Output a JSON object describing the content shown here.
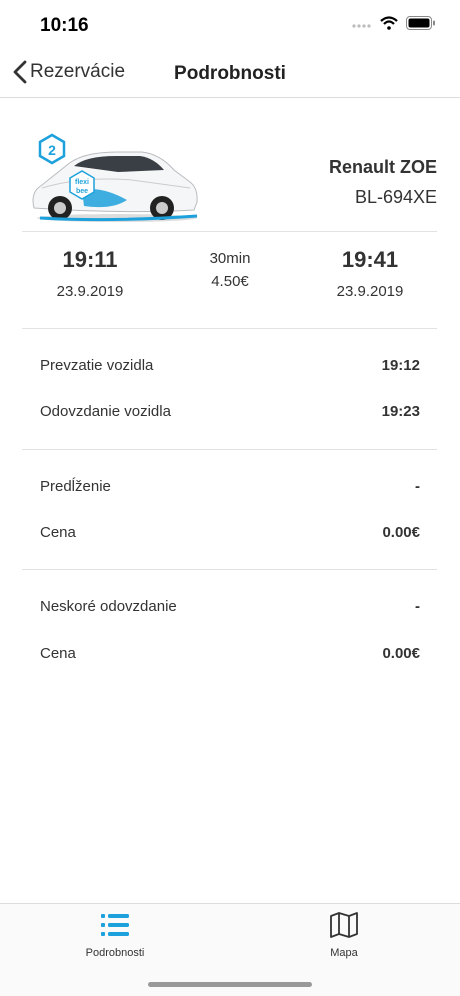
{
  "status": {
    "time": "10:16"
  },
  "nav": {
    "back_label": "Rezervácie",
    "title": "Podrobnosti"
  },
  "car": {
    "badge_number": "2",
    "brand_text_1": "flexi",
    "brand_text_2": "bee",
    "name": "Renault ZOE",
    "plate": "BL-694XE"
  },
  "booking": {
    "start_time": "19:11",
    "start_date": "23.9.2019",
    "duration": "30min",
    "price": "4.50€",
    "end_time": "19:41",
    "end_date": "23.9.2019"
  },
  "details": {
    "pickup_label": "Prevzatie vozidla",
    "pickup_value": "19:12",
    "return_label": "Odovzdanie vozidla",
    "return_value": "19:23",
    "extension_label": "Predĺženie",
    "extension_value": "-",
    "extension_price_label": "Cena",
    "extension_price_value": "0.00€",
    "late_label": "Neskoré odovzdanie",
    "late_value": "-",
    "late_price_label": "Cena",
    "late_price_value": "0.00€"
  },
  "tabs": [
    {
      "label": "Podrobnosti",
      "icon": "list-icon",
      "active": true
    },
    {
      "label": "Mapa",
      "icon": "map-icon",
      "active": false
    }
  ],
  "colors": {
    "accent": "#1da1dc",
    "text": "#333333"
  }
}
